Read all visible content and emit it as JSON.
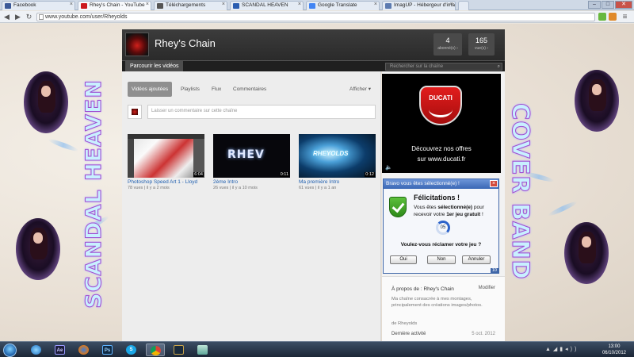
{
  "browser": {
    "tabs": [
      {
        "label": "Facebook",
        "favicon_color": "#3b5998"
      },
      {
        "label": "Rhey's Chain - YouTube",
        "favicon_color": "#cc181e"
      },
      {
        "label": "Téléchargements",
        "favicon_color": "#555555"
      },
      {
        "label": "SCANDAL HEAVEN",
        "favicon_color": "#2a5db0"
      },
      {
        "label": "Google Translate",
        "favicon_color": "#4285f4"
      },
      {
        "label": "ImagUP - Hébergeur d'ima",
        "favicon_color": "#5b7ab0"
      }
    ],
    "address": "www.youtube.com/user/Rheyolds"
  },
  "art": {
    "left_text": "SCANDAL HEAVEN",
    "right_text": "COVER BAND"
  },
  "channel": {
    "name": "Rhey's Chain",
    "subscribers": {
      "count": "4",
      "label": "abonné(s) ›"
    },
    "views": {
      "count": "165",
      "label": "vue(s) ›"
    },
    "nav_tab": "Parcourir les vidéos",
    "search_placeholder": "Rechercher sur la chaîne",
    "sub_tabs": [
      "Vidéos ajoutées",
      "Playlists",
      "Flux",
      "Commentaires"
    ],
    "afficher": "Afficher ▾",
    "comment_placeholder": "Laisser un commentaire sur cette chaîne"
  },
  "videos": [
    {
      "title": "Photoshop Speed Art 1 - Lloyd",
      "views": "78 vues",
      "age": "il y a 2 mois",
      "duration": "6:04"
    },
    {
      "title": "2ème Intro",
      "views": "26 vues",
      "age": "il y a 10 mois",
      "duration": "0:11"
    },
    {
      "title": "Ma première Intro",
      "views": "61 vues",
      "age": "il y a 1 an",
      "duration": "0:12"
    }
  ],
  "ad": {
    "brand": "DUCATI",
    "line1": "Découvrez nos offres",
    "line2": "sur www.ducati.fr"
  },
  "popup": {
    "title": "Bravo vous êtes sélectionné(e) !",
    "heading": "Félicitations !",
    "body_pre": "Vous êtes ",
    "body_bold1": "sélectionné(e)",
    "body_mid": " pour recevoir votre ",
    "body_bold2": "1er jeu gratuit",
    "body_post": " !",
    "countdown": "05",
    "question": "Voulez-vous réclamer votre jeu ?",
    "buttons": [
      "Oui",
      "Non",
      "Annuler"
    ],
    "badge": "10"
  },
  "about": {
    "title": "À propos de : Rhey's Chain",
    "edit": "Modifier",
    "description": "Ma chaîne consacrée à mes montages, principalement des créations images/photos.",
    "by": "de Rheyolds",
    "last_activity_label": "Dernière activité",
    "last_activity_date": "5 oct. 2012"
  },
  "taskbar": {
    "apps": [
      "Ae",
      "Ps",
      "S"
    ],
    "time": "13:00",
    "date": "06/10/2012"
  }
}
